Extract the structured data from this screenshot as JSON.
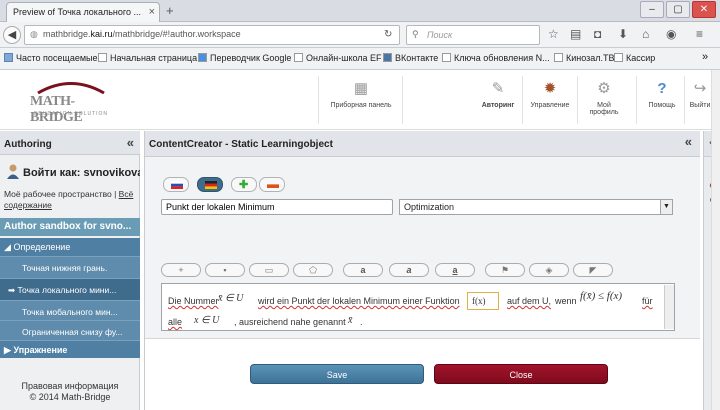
{
  "browser": {
    "tab_title": "Preview of Точка локального ...",
    "tab_close": "×",
    "new_tab": "+",
    "window_buttons": [
      "–",
      "▢",
      "✕"
    ],
    "url_prefix": "mathbridge.",
    "url_domain": "kai.ru",
    "url_rest": "/mathbridge/#!author.workspace",
    "search_placeholder": "Поиск",
    "bookmarks": [
      "Часто посещаемые",
      "Начальная страница",
      "Переводчик Google",
      "Онлайн-школа EF",
      "ВКонтакте",
      "Ключа обновления N...",
      "Кинозал.TB",
      "Кассир"
    ],
    "bookmarks_more": "»"
  },
  "app_header": {
    "logo_main": "MATH-BRIDGE",
    "logo_sub": "EDUCATION SOLUTION",
    "nav": [
      {
        "label": "Приборная панель",
        "icon": "dashboard-icon"
      },
      {
        "label": "Авторинг",
        "icon": "authoring-icon"
      },
      {
        "label": "Управление",
        "icon": "management-icon"
      },
      {
        "label": "Мой профиль",
        "icon": "profile-icon"
      },
      {
        "label": "Помощь",
        "icon": "help-icon"
      },
      {
        "label": "Выйти",
        "icon": "logout-icon"
      }
    ]
  },
  "left_sidebar": {
    "title": "Authoring",
    "collapse": "«",
    "login_text": "Войти как: svnovikova",
    "workspace_text": "Моё рабочее пространство | ",
    "workspace_link_1": "Всё",
    "workspace_link_2": "содержание",
    "sandbox_title": "Author sandbox for svno...",
    "section_definition": "Определение",
    "items": [
      "Точная нижняя грань.",
      "Точка локального мини...",
      "Точка мобального мин...",
      "Ограниченная снизу фу..."
    ],
    "active_index": 1,
    "section_exercise": "Упражнение",
    "legal_1": "Правовая информация",
    "legal_2": "© 2014 Math-Bridge"
  },
  "main": {
    "title": "ContentCreator - Static Learningobject",
    "collapse": "«",
    "title_value": "Punkt der lokalen Minimum",
    "type_value": "Optimization",
    "toolbar_icons": [
      "plus-icon",
      "image-icon",
      "link-icon",
      "shape-icon",
      "text-a-icon",
      "italic-a-icon",
      "underline-a-icon",
      "flag-icon",
      "bell-icon",
      "comment-icon"
    ],
    "content": {
      "t1": "Die Nummer",
      "m1": "x̄ ∈ U",
      "t2": "wird ein Punkt der lokalen Minimum einer Funktion",
      "fx": "f(x)",
      "t3": "auf dem U,",
      "t4": "wenn",
      "m2": "f(x̄) ≤ f(x)",
      "t5": "für",
      "t6": "alle",
      "m3": "x ∈ U",
      "t7": ", ausreichend nahe genannt",
      "m4": "x̄",
      "t8": "."
    },
    "save_label": "Save",
    "close_label": "Close"
  },
  "right_sidebar": {
    "collapse": "«"
  }
}
